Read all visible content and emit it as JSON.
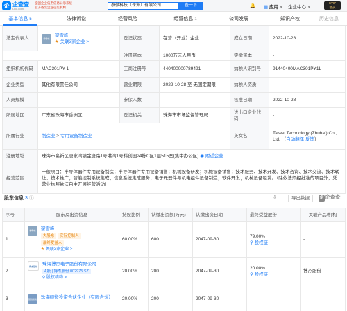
{
  "topbar": {
    "logo_char": "企",
    "logo_text": "企查查",
    "logo_url": "Qcc.com",
    "slogan_line1": "全国企业信用信息公示系统",
    "slogan_line2": "官方备案企业征信机构",
    "search_value": "泰微科技（珠海）有限公司",
    "search_button": "查一下",
    "apps_label": "应用",
    "enterprise_center": "企业中心",
    "svip_top": "SVIP",
    "svip_bottom": "会员"
  },
  "tabs": [
    {
      "label": "基本信息",
      "count": "5"
    },
    {
      "label": "法律诉讼",
      "count": ""
    },
    {
      "label": "经营风险",
      "count": ""
    },
    {
      "label": "经营信息",
      "count": "1"
    },
    {
      "label": "公司发展",
      "count": ""
    },
    {
      "label": "知识产权",
      "count": ""
    },
    {
      "label": "历史信息",
      "count": ""
    }
  ],
  "basic": {
    "legal_rep_label": "法定代表人",
    "legal_rep_avatar": "黎雪峰",
    "legal_rep_name": "黎雪峰",
    "legal_rep_related": "关联3家企业 >",
    "status_label": "登记状态",
    "status_value": "在营（开业）企业",
    "established_label": "成立日期",
    "established_value": "2022-10-28",
    "reg_capital_label": "注册资本",
    "reg_capital_value": "1000万元人民币",
    "paid_capital_label": "实缴资本",
    "paid_capital_value": "-",
    "org_code_label": "组织机构代码",
    "org_code_value": "MAC301PY-1",
    "biz_reg_no_label": "工商注册号",
    "biz_reg_no_value": "440400000789491",
    "taxpayer_id_label": "纳税人识别号",
    "taxpayer_id_value": "91440400MAC301PY1L",
    "credit_code_label": "统一社会信用代码",
    "credit_code_value": "91440400MAC301PY1L",
    "company_type_label": "企业类型",
    "company_type_value": "其他有限责任公司",
    "term_label": "营业期限",
    "term_value": "2022-10-28 至 无固定期限",
    "taxpayer_q_label": "纳税人资质",
    "taxpayer_q_value": "-",
    "staff_label": "人员规模",
    "staff_value": "-",
    "insured_label": "参保人数",
    "insured_value": "-",
    "approval_label": "核准日期",
    "approval_value": "2022-10-28",
    "region_label": "所属地区",
    "region_value": "广东省珠海市香洲区",
    "authority_label": "登记机关",
    "authority_value": "珠海市市场监督管理局",
    "import_export_label": "进出口企业代码",
    "import_export_value": "-",
    "industry_label": "所属行业",
    "industry_value_1": "制造业",
    "industry_sep": " > ",
    "industry_value_2": "专用设备制造业",
    "english_label": "英文名",
    "english_value": "Taiwei Technology (Zhuhai) Co., Ltd.",
    "english_link": "自动翻译",
    "english_feedback": "反馈",
    "address_label": "注册地址",
    "address_value": "珠海市高新区唐家湾镇金唐路1号港湾1号科创园24栋C区1层515室(集中办公区)",
    "address_nearby": "附近企业",
    "scope_label": "经营范围",
    "scope_value": "一般项目：半导体器件专用设备制造；半导体器件专用设备销售；机械设备研发；机械设备销售；技术服务、技术开发、技术咨询、技术交流、技术转让、技术推广；智能控制系统集成；信息系统集成服务；电子元器件与机电组件设备制造；软件开发；机械设备租赁。（除依法须经批准的项目外，凭营业执照依法自主开展经营活动）"
  },
  "shareholders": {
    "title": "股东信息",
    "count": "3",
    "export_label": "导出数据",
    "watermark": "企查查",
    "headers": [
      "序号",
      "股东及出资信息",
      "持股比例",
      "认缴出资额(万元)",
      "认缴出资日期",
      "最终受益股份",
      "关联产品/机构"
    ],
    "rows": [
      {
        "idx": "1",
        "avatar": "黎雪峰",
        "avatar_color": "#8aa6c1",
        "name": "黎雪峰",
        "tags": [
          "大股东",
          "实际控制人",
          "最终受益人"
        ],
        "extra": "关联3家企业 >",
        "ratio": "60.00%",
        "amount": "600",
        "date": "2047-09-30",
        "benefit": "79.00%",
        "benefit_link": "股权链",
        "product": "-"
      },
      {
        "idx": "2",
        "avatar": "博杰股份",
        "avatar_color": "#1f5fa8",
        "name": "珠海博杰电子股份有限公司",
        "tags": [
          "A股 | 博杰股份 002975.SZ"
        ],
        "extra": "股权结构 >",
        "ratio": "20.00%",
        "amount": "200",
        "date": "2047-09-30",
        "benefit": "20.00%",
        "benefit_link": "股权链",
        "product": "博杰股份"
      },
      {
        "idx": "3",
        "avatar": "硕微投资",
        "avatar_color": "#7a9cc4",
        "name": "珠海硕微投资合伙企业（有限合伙）",
        "tags": [],
        "extra": "",
        "ratio": "20.00%",
        "amount": "200",
        "date": "2047-09-30",
        "benefit": "",
        "benefit_link": "",
        "product": ""
      }
    ]
  }
}
